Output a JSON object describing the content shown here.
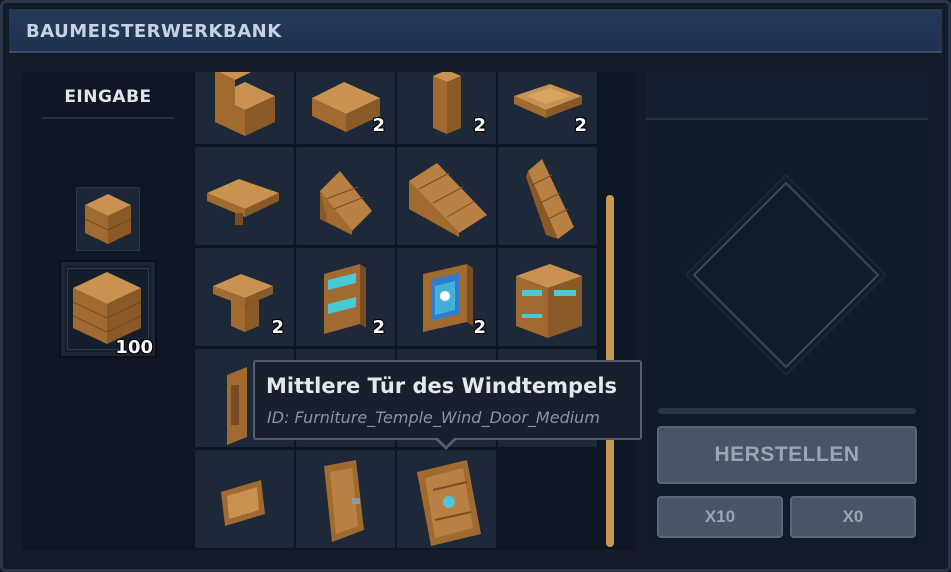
{
  "window": {
    "title": "BAUMEISTERWERKBANK"
  },
  "input": {
    "label": "EINGABE",
    "small_slot": {
      "icon": "wood-block-icon"
    },
    "main_slot": {
      "icon": "wood-block-icon",
      "count": "100"
    }
  },
  "recipes": [
    {
      "icon": "wood-stairs-icon",
      "count": ""
    },
    {
      "icon": "wood-slab-icon",
      "count": "2"
    },
    {
      "icon": "wood-pillar-icon",
      "count": "2"
    },
    {
      "icon": "wood-panel-icon",
      "count": "2"
    },
    {
      "icon": "wood-table-icon",
      "count": ""
    },
    {
      "icon": "wood-roof-small-icon",
      "count": ""
    },
    {
      "icon": "wood-roof-large-icon",
      "count": ""
    },
    {
      "icon": "wood-roof-tall-icon",
      "count": ""
    },
    {
      "icon": "wood-t-beam-icon",
      "count": "2"
    },
    {
      "icon": "wind-shelf-icon",
      "count": "2"
    },
    {
      "icon": "wind-window-icon",
      "count": "2"
    },
    {
      "icon": "wind-cabinet-icon",
      "count": ""
    },
    {
      "icon": "wood-door-small-icon",
      "count": ""
    },
    {
      "icon": "wood-sign-icon",
      "count": ""
    },
    {
      "icon": "wood-door-icon",
      "count": ""
    },
    {
      "icon": "wind-door-medium-icon",
      "count": ""
    }
  ],
  "tooltip": {
    "title": "Mittlere Tür des Windtempels",
    "subtitle": "ID: Furniture_Temple_Wind_Door_Medium"
  },
  "output": {
    "icon": "empty-diamond-slot-icon"
  },
  "buttons": {
    "craft": "HERSTELLEN",
    "x10": "X10",
    "x0": "X0"
  },
  "colors": {
    "title_bar": "#253a59",
    "panel": "#0f1724",
    "slot": "#1d2839",
    "scroll_thumb": "#c9974f",
    "wood": "#b07a3c",
    "wind_accent": "#4ac8d8"
  }
}
